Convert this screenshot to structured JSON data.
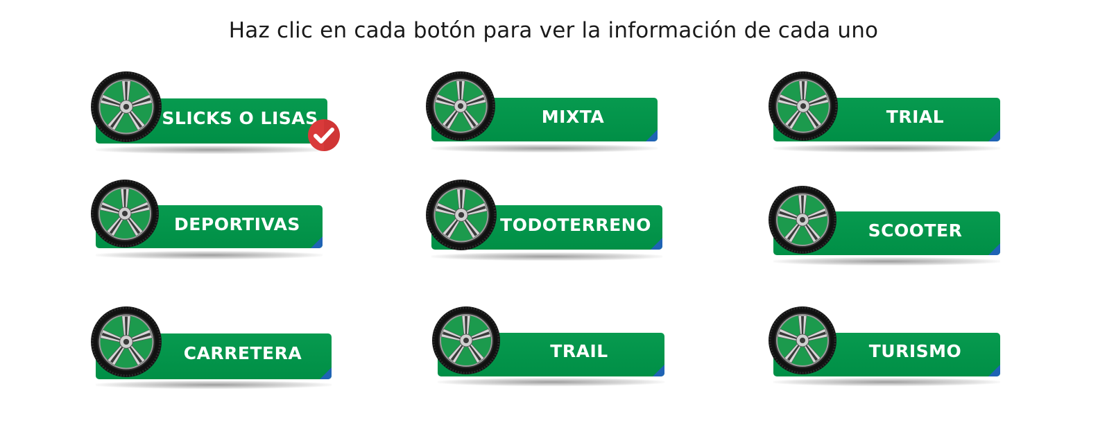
{
  "header": {
    "instruction": "Haz clic en cada botón para ver la información de cada uno"
  },
  "colors": {
    "button_green": "#009448",
    "corner_blue": "#1f63b5",
    "check_red": "#d93a3a"
  },
  "buttons": [
    {
      "label": "SLICKS O LISAS",
      "visited": true,
      "icon": "wheel-icon"
    },
    {
      "label": "MIXTA",
      "visited": false,
      "icon": "wheel-icon"
    },
    {
      "label": "TRIAL",
      "visited": false,
      "icon": "wheel-icon"
    },
    {
      "label": "DEPORTIVAS",
      "visited": false,
      "icon": "wheel-icon"
    },
    {
      "label": "TODOTERRENO",
      "visited": false,
      "icon": "wheel-icon"
    },
    {
      "label": "SCOOTER",
      "visited": false,
      "icon": "wheel-icon"
    },
    {
      "label": "CARRETERA",
      "visited": false,
      "icon": "wheel-icon"
    },
    {
      "label": "TRAIL",
      "visited": false,
      "icon": "wheel-icon"
    },
    {
      "label": "TURISMO",
      "visited": false,
      "icon": "wheel-icon"
    }
  ],
  "badge": {
    "icon": "checkmark-icon"
  }
}
